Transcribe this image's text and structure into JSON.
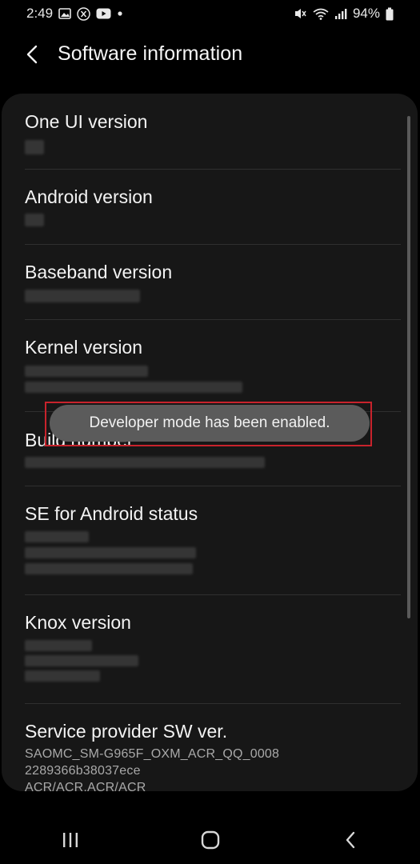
{
  "status_bar": {
    "time": "2:49",
    "left_icons": [
      "gallery-icon",
      "x-logo-icon",
      "youtube-icon",
      "dot-icon"
    ],
    "right_icons": [
      "mute-vibrate-icon",
      "wifi-icon",
      "signal-icon"
    ],
    "battery": "94%"
  },
  "header": {
    "title": "Software information"
  },
  "items": [
    {
      "title": "One UI version"
    },
    {
      "title": "Android version"
    },
    {
      "title": "Baseband version"
    },
    {
      "title": "Kernel version"
    },
    {
      "title": "Build number"
    },
    {
      "title": "SE for Android status"
    },
    {
      "title": "Knox version"
    },
    {
      "title": "Service provider SW ver.",
      "lines": [
        "SAOMC_SM-G965F_OXM_ACR_QQ_0008",
        "2289366b38037ece",
        "ACR/ACR,ACR/ACR"
      ]
    }
  ],
  "toast": {
    "message": "Developer mode has been enabled."
  },
  "colors": {
    "background": "#000000",
    "card": "#171717",
    "toast": "#5b5b5b",
    "highlight": "#c8232c"
  }
}
